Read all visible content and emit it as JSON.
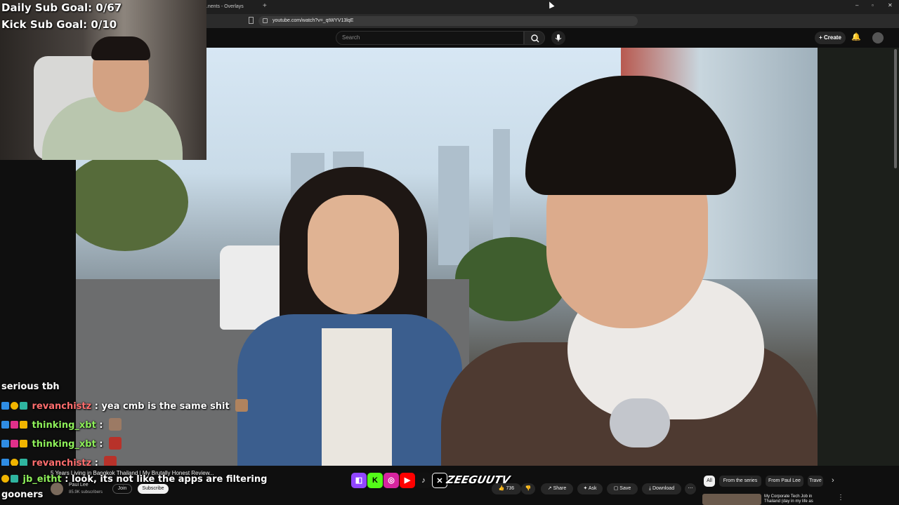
{
  "stream_overlay": {
    "daily_goal": "Daily Sub Goal: 0/67",
    "kick_goal": "Kick Sub Goal: 0/10"
  },
  "browser": {
    "tab_title": "...nents - Overlays",
    "url": "youtube.com/watch?v=_qtWYV13lqE"
  },
  "youtube": {
    "search_placeholder": "Search",
    "create_label": "Create"
  },
  "video": {
    "title": "5 Years Living in Bangkok Thailand | My Brutally Honest Review...",
    "channel": "Paul Lee",
    "subscribers": "85.9K subscribers",
    "join_label": "Join",
    "subscribe_label": "Subscribe",
    "likes": "736",
    "share_label": "Share",
    "ask_label": "Ask",
    "save_label": "Save",
    "download_label": "Download"
  },
  "chips": [
    "All",
    "From the series",
    "From Paul Lee",
    "Trave"
  ],
  "recommended": {
    "title": "My Corporate Tech Job in Thailand (day in my life as"
  },
  "chat": [
    {
      "user": "",
      "text": "serious tbh"
    },
    {
      "user": "revanchistz",
      "text": ": yea cmb is the same shit"
    },
    {
      "user": "thinking_xbt",
      "text": ":"
    },
    {
      "user": "thinking_xbt",
      "text": ":"
    },
    {
      "user": "revanchistz",
      "text": ":"
    },
    {
      "user": "jb_eitht",
      "text": ": look, its not like the apps are filtering"
    },
    {
      "user": "",
      "text": "gooners"
    }
  ],
  "logo_text": "ZEEGUUTV",
  "colors": {
    "twitch": "#9146ff",
    "kick": "#53fc18",
    "youtube": "#ff0000",
    "username_green": "#8ef05a",
    "username_red": "#ff6e6e"
  }
}
